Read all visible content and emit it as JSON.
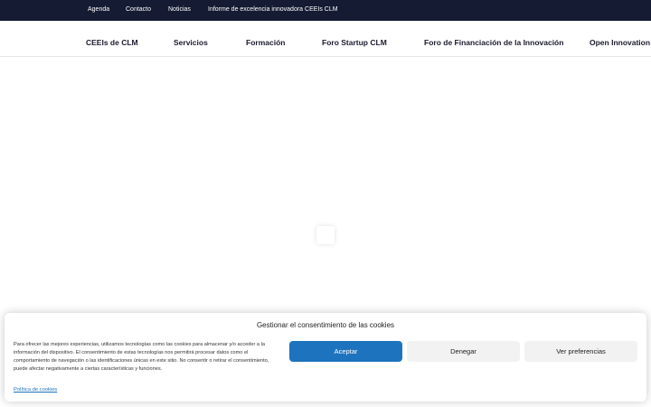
{
  "topbar": {
    "links": [
      "Agenda",
      "Contacto",
      "Noticias",
      "Informe de excelencia innovadora CEEIs CLM"
    ]
  },
  "mainnav": {
    "items": [
      "CEEIs de CLM",
      "Servicios",
      "Formación",
      "Foro Startup CLM",
      "Foro de Financiación de la Innovación",
      "Open Innovation C"
    ]
  },
  "cookie": {
    "title": "Gestionar el consentimiento de las cookies",
    "text": "Para ofrecer las mejores experiencias, utilizamos tecnologías como las cookies para almacenar y/o acceder a la información del dispositivo. El consentimiento de estas tecnologías nos permitirá procesar datos como el comportamiento de navegación o las identificaciones únicas en este sitio. No consentir o retirar el consentimiento, puede afectar negativamente a ciertas características y funciones.",
    "accept_label": "Aceptar",
    "deny_label": "Denegar",
    "prefs_label": "Ver preferencias",
    "policy_label": "Política de cookies"
  },
  "colors": {
    "topbar_bg": "#141b33",
    "accent": "#1e73be"
  }
}
